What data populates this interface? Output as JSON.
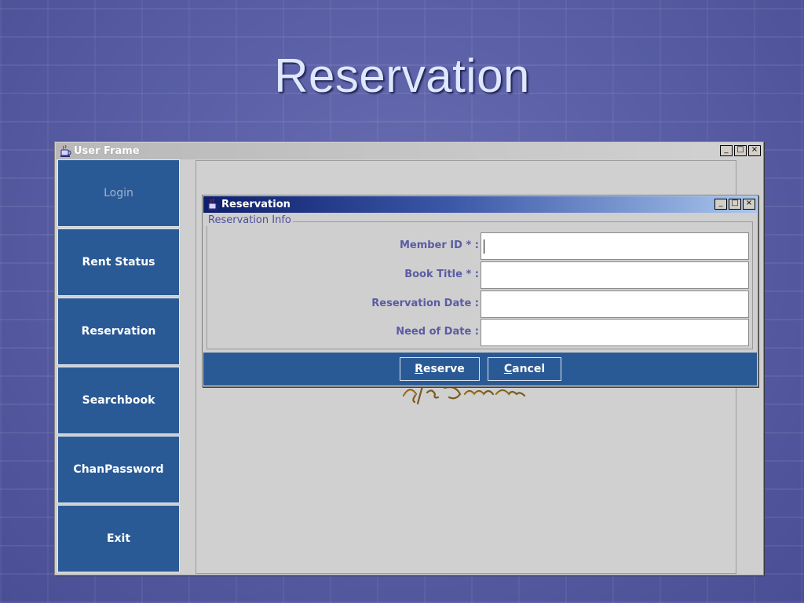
{
  "slide": {
    "title": "Reservation"
  },
  "user_frame": {
    "title": "User Frame",
    "window_controls": [
      "_",
      "□",
      "×"
    ],
    "sidebar": [
      {
        "label": "Login",
        "enabled": false
      },
      {
        "label": "Rent Status",
        "enabled": true
      },
      {
        "label": "Reservation",
        "enabled": true
      },
      {
        "label": "Searchbook",
        "enabled": true
      },
      {
        "label": "ChanPassword",
        "enabled": true
      },
      {
        "label": "Exit",
        "enabled": true
      }
    ]
  },
  "reservation_window": {
    "title": "Reservation",
    "group_title": "Reservation Info",
    "fields": [
      {
        "label": "Member ID *  :",
        "value": ""
      },
      {
        "label": "Book Title *  :",
        "value": ""
      },
      {
        "label": "Reservation Date  :",
        "value": ""
      },
      {
        "label": "Need of Date  :",
        "value": ""
      }
    ],
    "buttons": {
      "reserve": {
        "mnemonic": "R",
        "rest": "eserve"
      },
      "cancel": {
        "mnemonic": "C",
        "rest": "ancel"
      }
    }
  },
  "colors": {
    "button_blue": "#2a5a95",
    "label_purple": "#5a5ca4",
    "background": "#575ca3"
  }
}
